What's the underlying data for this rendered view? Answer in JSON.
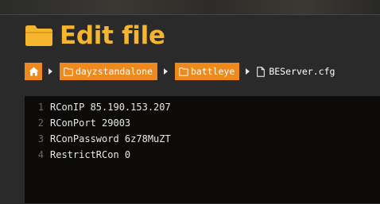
{
  "header": {
    "title": "Edit file",
    "icon": "folder-icon",
    "accent_color": "#f5b52e"
  },
  "breadcrumb": {
    "home_icon": "home-icon",
    "items": [
      {
        "label": "dayzstandalone",
        "type": "folder"
      },
      {
        "label": "battleye",
        "type": "folder"
      }
    ],
    "file": {
      "label": "BEServer.cfg",
      "icon": "file-icon"
    },
    "crumb_color": "#ee8a1d"
  },
  "editor": {
    "lines": [
      {
        "number": "1",
        "text": "RConIP 85.190.153.207"
      },
      {
        "number": "2",
        "text": "RConPort 29003"
      },
      {
        "number": "3",
        "text": "RConPassword 6z78MuZT"
      },
      {
        "number": "4",
        "text": "RestrictRCon 0"
      }
    ]
  }
}
